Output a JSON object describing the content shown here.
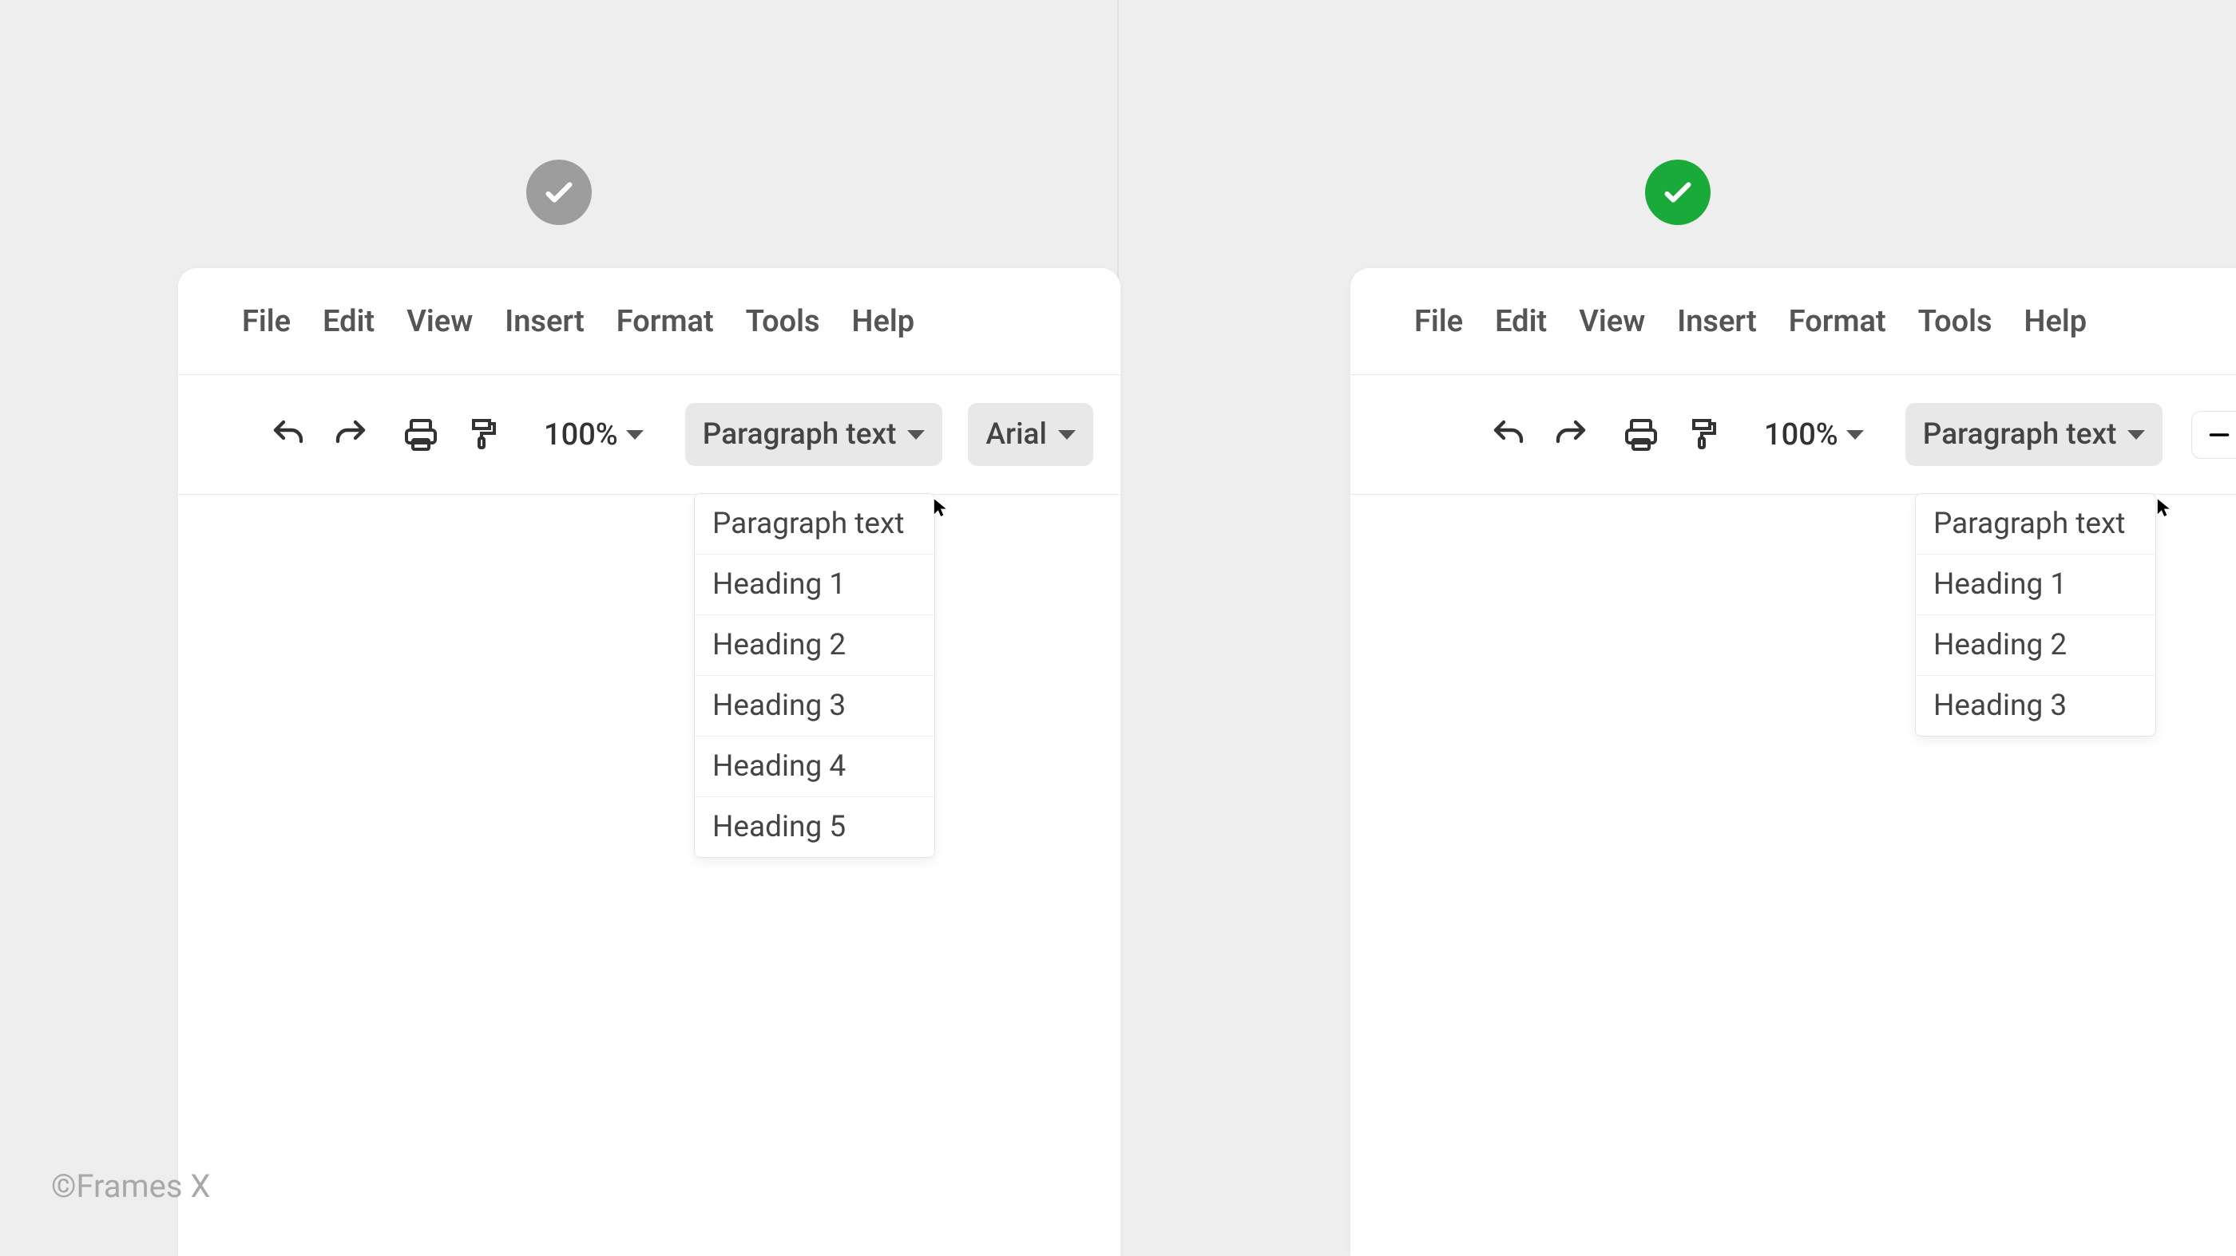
{
  "copyright": "©Frames X",
  "menubar": [
    "File",
    "Edit",
    "View",
    "Insert",
    "Format",
    "Tools",
    "Help"
  ],
  "toolbar": {
    "zoom": "100%",
    "style_selector": "Paragraph text",
    "font_selector": "Arial"
  },
  "left": {
    "badge": "gray",
    "dropdown_options": [
      "Paragraph text",
      "Heading 1",
      "Heading 2",
      "Heading 3",
      "Heading 4",
      "Heading 5"
    ]
  },
  "right": {
    "badge": "green",
    "dropdown_options": [
      "Paragraph text",
      "Heading 1",
      "Heading 2",
      "Heading 3"
    ]
  }
}
